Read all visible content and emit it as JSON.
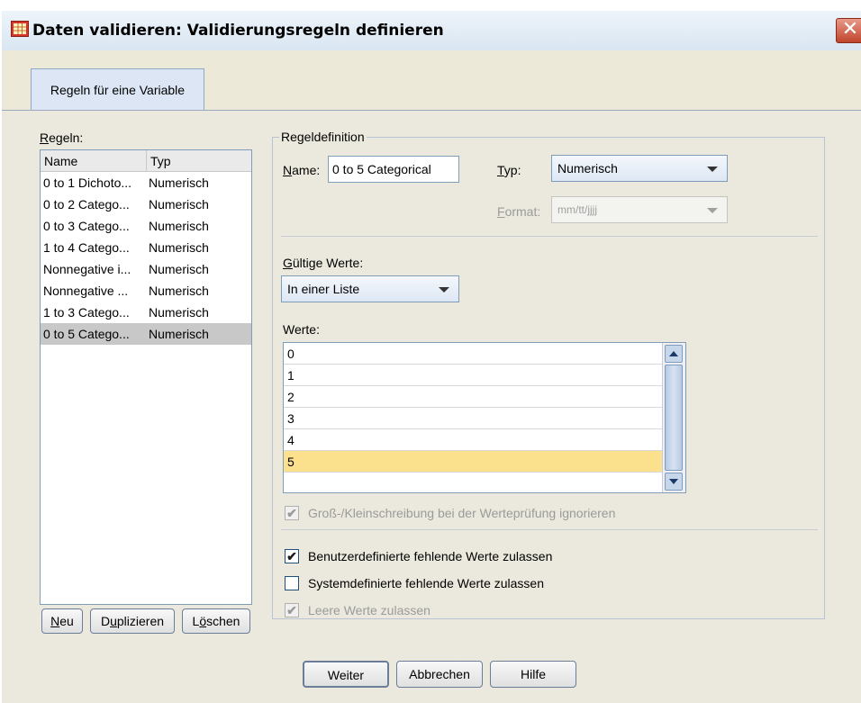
{
  "window": {
    "title": "Daten validieren: Validierungsregeln definieren",
    "close_glyph": "✕"
  },
  "tabs": [
    {
      "label": "Regeln für eine Variable"
    }
  ],
  "rules": {
    "label": "Regeln:",
    "columns": [
      "Name",
      "Typ"
    ],
    "rows": [
      {
        "name": "0 to 1 Dichoto...",
        "type": "Numerisch"
      },
      {
        "name": "0 to 2 Catego...",
        "type": "Numerisch"
      },
      {
        "name": "0 to 3 Catego...",
        "type": "Numerisch"
      },
      {
        "name": "1 to 4 Catego...",
        "type": "Numerisch"
      },
      {
        "name": "Nonnegative i...",
        "type": "Numerisch"
      },
      {
        "name": "Nonnegative ...",
        "type": "Numerisch"
      },
      {
        "name": "1 to 3 Catego...",
        "type": "Numerisch"
      },
      {
        "name": "0 to 5 Catego...",
        "type": "Numerisch",
        "selected": true
      }
    ],
    "buttons": {
      "new": "Neu",
      "duplicate": "Duplizieren",
      "delete": "Löschen"
    }
  },
  "definition": {
    "group_label": "Regeldefinition",
    "name_label": "Name:",
    "name_value": "0 to 5 Categorical",
    "type_label": "Typ:",
    "type_value": "Numerisch",
    "format_label": "Format:",
    "format_value": "mm/tt/jjjj",
    "valid_values_label": "Gültige Werte:",
    "valid_values_mode": "In einer Liste",
    "values_label": "Werte:",
    "values": [
      "0",
      "1",
      "2",
      "3",
      "4",
      "5",
      ""
    ],
    "selected_value_index": 5,
    "ignore_case_label": "Groß-/Kleinschreibung bei der Werteprüfung ignorieren",
    "ignore_case_checked": true,
    "user_missing_label": "Benutzerdefinierte fehlende Werte zulassen",
    "user_missing_checked": true,
    "system_missing_label": "Systemdefinierte fehlende Werte zulassen",
    "system_missing_checked": false,
    "empty_values_label": "Leere Werte zulassen",
    "empty_values_checked": true
  },
  "footer": {
    "continue": "Weiter",
    "cancel": "Abbrechen",
    "help": "Hilfe"
  },
  "colors": {
    "selection": "#fbe08e",
    "list_selection": "#c8c8c8"
  }
}
